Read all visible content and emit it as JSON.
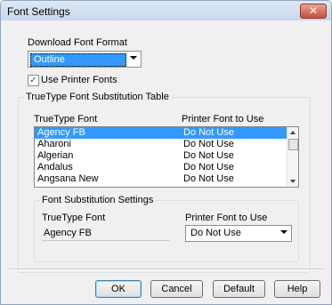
{
  "window": {
    "title": "Font Settings",
    "close_glyph": "✕"
  },
  "download_format": {
    "label": "Download Font Format",
    "value": "Outline"
  },
  "use_printer_fonts": {
    "label": "Use Printer Fonts",
    "checked": true,
    "check_glyph": "✓"
  },
  "table": {
    "group_title": "TrueType Font Substitution Table",
    "col_truetype": "TrueType Font",
    "col_printer": "Printer Font to Use",
    "rows": [
      {
        "font": "Agency FB",
        "printer": "Do Not Use",
        "selected": true
      },
      {
        "font": "Aharoni",
        "printer": "Do Not Use"
      },
      {
        "font": "Algerian",
        "printer": "Do Not Use"
      },
      {
        "font": "Andalus",
        "printer": "Do Not Use"
      },
      {
        "font": "Angsana New",
        "printer": "Do Not Use"
      }
    ]
  },
  "substitution": {
    "group_title": "Font Substitution Settings",
    "truetype_label": "TrueType Font",
    "truetype_value": "Agency FB",
    "printer_label": "Printer Font to Use",
    "printer_value": "Do Not Use"
  },
  "buttons": {
    "ok": "OK",
    "cancel": "Cancel",
    "default": "Default",
    "help": "Help"
  },
  "colors": {
    "selection": "#3399ff",
    "dialog_bg": "#f0f0f0"
  }
}
